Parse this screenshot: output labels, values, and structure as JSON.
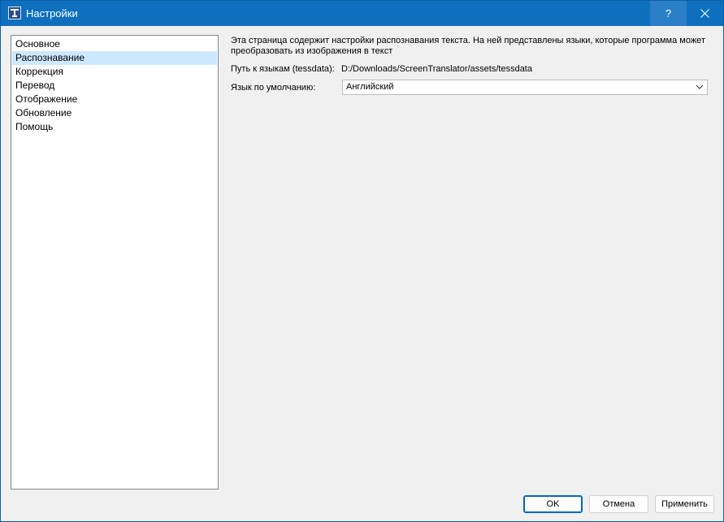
{
  "window": {
    "title": "Настройки",
    "help_label": "?",
    "icon": "screen-translator-icon",
    "accent_color": "#0e6fbf"
  },
  "sidebar": {
    "items": [
      {
        "label": "Основное",
        "selected": false
      },
      {
        "label": "Распознавание",
        "selected": true
      },
      {
        "label": "Коррекция",
        "selected": false
      },
      {
        "label": "Перевод",
        "selected": false
      },
      {
        "label": "Отображение",
        "selected": false
      },
      {
        "label": "Обновление",
        "selected": false
      },
      {
        "label": "Помощь",
        "selected": false
      }
    ],
    "selected_color": "#cce8ff"
  },
  "page": {
    "description": "Эта страница содержит настройки распознавания текста. На ней представлены языки, которые программа может преобразовать из изображения в текст",
    "tessdata_label": "Путь к языкам (tessdata):",
    "tessdata_path": "D:/Downloads/ScreenTranslator/assets/tessdata",
    "default_language_label": "Язык по умолчанию:",
    "default_language_value": "Английский"
  },
  "buttons": {
    "ok": "OK",
    "cancel": "Отмена",
    "apply": "Применить"
  }
}
